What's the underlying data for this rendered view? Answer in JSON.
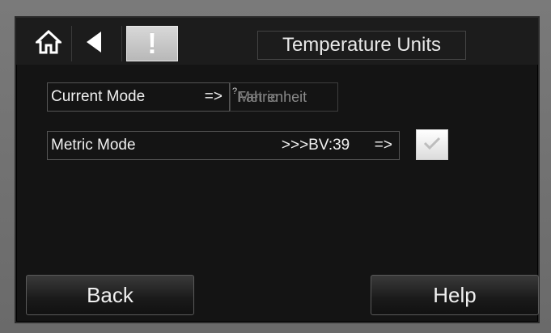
{
  "header": {
    "title": "Temperature Units",
    "home_icon": "home-icon",
    "back_icon": "back-arrow-icon",
    "alert_icon": "exclamation-icon",
    "alert_symbol": "!"
  },
  "rows": {
    "current_mode": {
      "label": "Current Mode",
      "arrow": "=>",
      "value": "Fahrenheit",
      "overlay": "Metric",
      "glitch_mark": "?"
    },
    "metric_mode": {
      "label": "Metric Mode",
      "value": ">>>BV:39",
      "arrow": "=>",
      "checkbox_checked": true
    }
  },
  "footer": {
    "back_label": "Back",
    "help_label": "Help"
  },
  "colors": {
    "screen_bg": "#141414",
    "bezel": "#6f6f6f",
    "alert_button": "#c8c8c8",
    "text": "#f0f0f0",
    "dim_text": "#8a8a8a"
  }
}
